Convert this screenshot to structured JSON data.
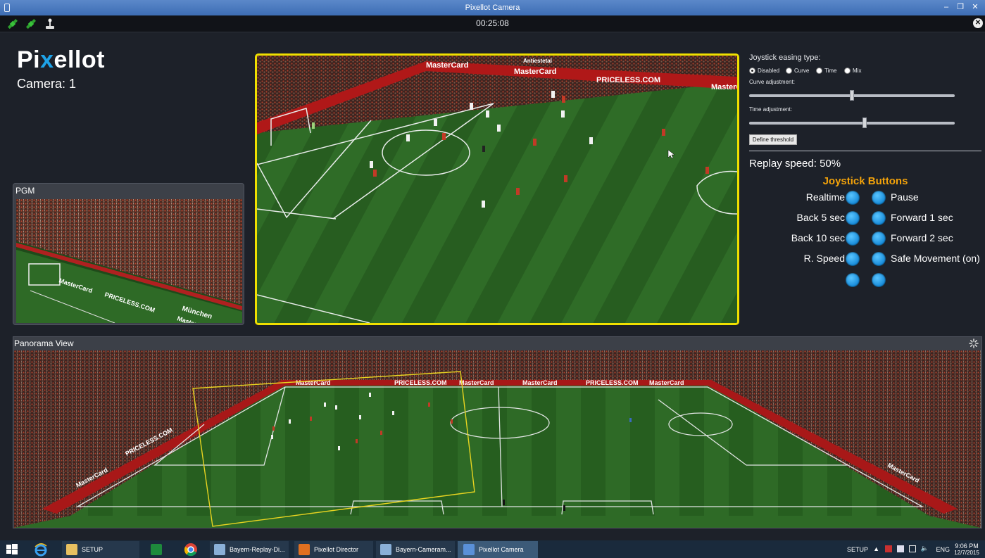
{
  "window": {
    "title": "Pixellot Camera",
    "controls": [
      "–",
      "❐",
      "✕"
    ]
  },
  "toolbar": {
    "tools": [
      "satellite-green-icon",
      "satellite-green-icon",
      "joystick-icon"
    ],
    "timer": "00:25:08",
    "close_glyph": "✕"
  },
  "brand": {
    "logo_left": "Pi",
    "logo_x": "x",
    "logo_right": "ellot",
    "camera_label": "Camera: 1"
  },
  "pgm": {
    "title": "PGM"
  },
  "controls": {
    "easing_label": "Joystick easing type:",
    "easing_options": [
      {
        "label": "Disabled",
        "selected": true
      },
      {
        "label": "Curve",
        "selected": false
      },
      {
        "label": "Time",
        "selected": false
      },
      {
        "label": "Mix",
        "selected": false
      }
    ],
    "curve_label": "Curve adjustment:",
    "curve_value": 0.5,
    "time_label": "Time adjustment:",
    "time_value": 0.56,
    "threshold_button": "Define threshold",
    "replay_speed": "Replay speed: 50%",
    "joystick_title": "Joystick Buttons",
    "joystick_rows": [
      {
        "left": "Realtime",
        "right": "Pause"
      },
      {
        "left": "Back 5 sec",
        "right": "Forward 1 sec"
      },
      {
        "left": "Back 10 sec",
        "right": "Forward 2 sec"
      },
      {
        "left": "R. Speed",
        "right": "Safe Movement (on)"
      },
      {
        "left": "",
        "right": ""
      }
    ]
  },
  "panorama": {
    "title": "Panorama View"
  },
  "stadium_text": {
    "boards": [
      "MasterCard",
      "MasterCard",
      "PRICELESS.COM",
      "MasterCard",
      "Antiestetal"
    ],
    "pgm_boards": [
      "MasterCard",
      "PRICELESS.COM",
      "München",
      "MasterCard"
    ],
    "pano_boards": [
      "MasterCard",
      "PRICELESS.COM",
      "MasterCard",
      "MasterCard",
      "PRICELESS.COM",
      "MasterCard",
      "MasterCard",
      "PRICELESS.COM",
      "MasterCard"
    ]
  },
  "taskbar": {
    "items": [
      {
        "icon": "windows-start-icon",
        "label": ""
      },
      {
        "icon": "internet-explorer-icon",
        "label": ""
      },
      {
        "icon": "folder-icon",
        "label": "SETUP"
      },
      {
        "icon": "excel-icon",
        "label": ""
      },
      {
        "icon": "chrome-icon",
        "label": ""
      },
      {
        "icon": "app-window-icon",
        "label": "Bayern-Replay-Di..."
      },
      {
        "icon": "pixellot-director-icon",
        "label": "Pixellot Director"
      },
      {
        "icon": "app-window-icon",
        "label": "Bayern-Cameram..."
      },
      {
        "icon": "pixellot-camera-icon",
        "label": "Pixellot Camera"
      }
    ],
    "tray_label": "SETUP",
    "language": "ENG",
    "time": "9:06 PM",
    "date": "12/7/2015"
  },
  "colors": {
    "accent_yellow": "#f0e000",
    "joystick_orange": "#f2a20a",
    "button_blue": "#1ea3e8",
    "pitch_green": "#2e6a26"
  }
}
